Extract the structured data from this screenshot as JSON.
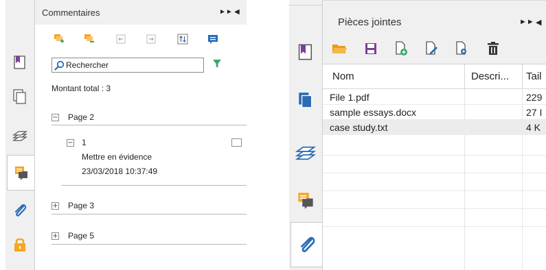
{
  "comments_panel": {
    "title": "Commentaires",
    "search": {
      "placeholder": "Rechercher"
    },
    "total_label": "Montant total : 3",
    "pages": [
      {
        "label": "Page 2",
        "expanded": true,
        "comments": [
          {
            "number": "1",
            "type": "Mettre en évidence",
            "datetime": "23/03/2018 10:37:49"
          }
        ]
      },
      {
        "label": "Page 3",
        "expanded": false
      },
      {
        "label": "Page 5",
        "expanded": false
      }
    ],
    "sidebar_tabs": [
      "bookmark-icon",
      "pages-icon",
      "layers-icon",
      "comments-icon",
      "attachment-icon",
      "lock-icon"
    ],
    "active_tab": "comments-icon",
    "toolbar_icons": [
      "expand-all-icon",
      "collapse-all-icon",
      "import-icon",
      "export-icon",
      "sort-icon",
      "comment-popup-icon"
    ]
  },
  "attachments_panel": {
    "title": "Pièces jointes",
    "columns": [
      "Nom",
      "Descri...",
      "Tail"
    ],
    "files": [
      {
        "name": "File 1.pdf",
        "description": "",
        "size": "229"
      },
      {
        "name": "sample essays.docx",
        "description": "",
        "size": "27 I"
      },
      {
        "name": "case study.txt",
        "description": "",
        "size": "4 K"
      }
    ],
    "selected_row": 2,
    "sidebar_tabs": [
      "bookmark-icon",
      "pages-icon",
      "layers-icon",
      "comments-icon",
      "attachment-icon"
    ],
    "active_tab": "attachment-icon",
    "toolbar_icons": [
      "open-folder-icon",
      "save-icon",
      "add-file-icon",
      "edit-description-icon",
      "settings-icon",
      "delete-icon"
    ]
  },
  "colors": {
    "accent_orange": "#f5a623",
    "accent_purple": "#7b3f9a",
    "accent_blue": "#2b6cb5",
    "accent_green": "#3aa86b",
    "panel_bg": "#f0f0f0"
  }
}
